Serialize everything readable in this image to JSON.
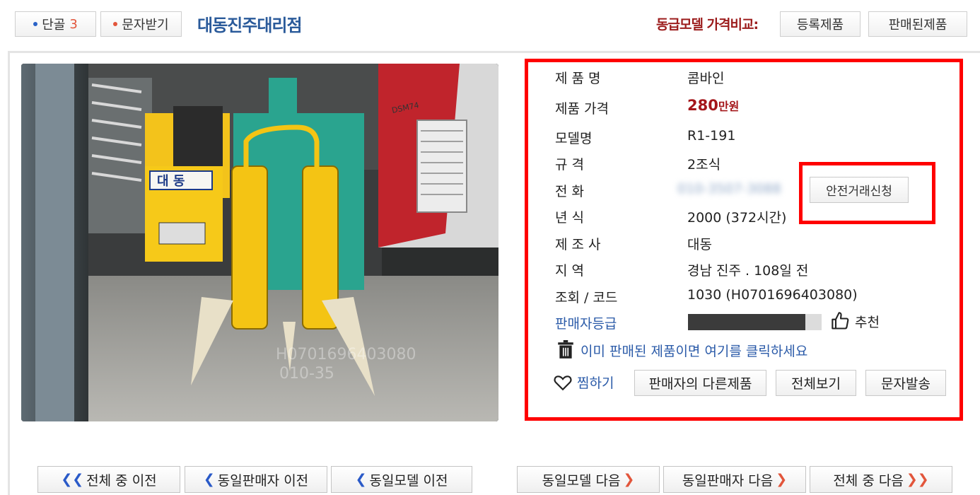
{
  "header": {
    "dangol_label": "단골",
    "dangol_count": "3",
    "sms_label": "문자받기",
    "shop_name": "대동진주대리점",
    "compare_label": "동급모델 가격비교:",
    "registered_label": "등록제품",
    "sold_label": "판매된제품"
  },
  "photo": {
    "logo_text": "대 동",
    "model_badge": "DSM74",
    "watermark_line1": "H0701696403080",
    "watermark_line2": "010-35"
  },
  "product": {
    "name_label": "제 품 명",
    "name_value": "콤바인",
    "price_label": "제품 가격",
    "price_number": "280",
    "price_unit": "만원",
    "model_label": "모델명",
    "model_value": "R1-191",
    "spec_label": "규 격",
    "spec_value": "2조식",
    "phone_label": "전 화",
    "phone_value": "010-3507-3088",
    "year_label": "년 식",
    "year_value": "2000  (372시간)",
    "maker_label": "제 조 사",
    "maker_value": "대동",
    "region_label": "지 역",
    "region_value": "경남 진주 . 108일 전",
    "views_label": "조회 / 코드",
    "views_value": "1030 (H0701696403080)",
    "seller_grade_label": "판매자등급",
    "seller_grade_level": 0.88,
    "recommend_label": "추천"
  },
  "actions": {
    "safe_trade": "안전거래신청",
    "sold_notice": "이미 판매된 제품이면 여기를 클릭하세요",
    "wishlist": "찜하기",
    "seller_other": "판매자의 다른제품",
    "view_all": "전체보기",
    "send_sms": "문자발송"
  },
  "nav": {
    "all_prev": "전체 중 이전",
    "seller_prev": "동일판매자 이전",
    "model_prev": "동일모델 이전",
    "model_next": "동일모델 다음",
    "seller_next": "동일판매자 다음",
    "all_next": "전체 중 다음"
  },
  "colors": {
    "highlight_box": "#ff0000",
    "price": "#a4161a",
    "link_blue": "#2a5aa8",
    "shop_name": "#2a5a9a"
  }
}
